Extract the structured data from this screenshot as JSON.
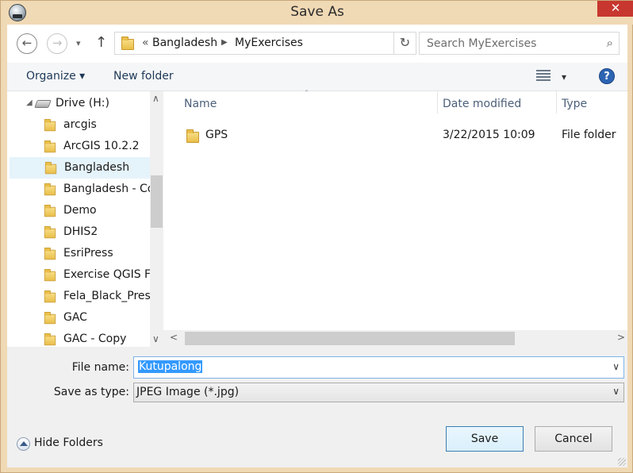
{
  "window": {
    "title": "Save As",
    "close_glyph": "✕"
  },
  "nav": {
    "back_glyph": "←",
    "forward_glyph": "→",
    "recent_glyph": "▾",
    "up_glyph": "↑",
    "address": {
      "overflow": "«",
      "crumbs": [
        "Bangladesh",
        "MyExercises"
      ],
      "separator": "▶",
      "refresh_glyph": "↻"
    },
    "search": {
      "placeholder": "Search MyExercises",
      "value": "",
      "icon_glyph": "⌕"
    }
  },
  "toolbar": {
    "organize_label": "Organize ▾",
    "new_folder_label": "New folder",
    "view_caret": "▾",
    "help_glyph": "?"
  },
  "navpane": {
    "drive_label": "Drive (H:)",
    "drive_arrow": "◢",
    "items": [
      {
        "label": "arcgis",
        "selected": false
      },
      {
        "label": "ArcGIS 10.2.2",
        "selected": false
      },
      {
        "label": "Bangladesh",
        "selected": true
      },
      {
        "label": "Bangladesh - Co",
        "selected": false
      },
      {
        "label": "Demo",
        "selected": false
      },
      {
        "label": "DHIS2",
        "selected": false
      },
      {
        "label": "EsriPress",
        "selected": false
      },
      {
        "label": "Exercise QGIS Fi",
        "selected": false
      },
      {
        "label": "Fela_Black_Presi",
        "selected": false
      },
      {
        "label": "GAC",
        "selected": false
      },
      {
        "label": "GAC - Copy",
        "selected": false
      }
    ],
    "scroll_up": "∧",
    "scroll_down": "∨"
  },
  "files": {
    "columns": {
      "name": "Name",
      "date": "Date modified",
      "type": "Type"
    },
    "sort_glyph": "˄",
    "rows": [
      {
        "name": "GPS",
        "date": "3/22/2015 10:09",
        "type": "File folder"
      }
    ],
    "scroll_left": "<",
    "scroll_right": ">"
  },
  "form": {
    "filename_label": "File name:",
    "filename_value": "Kutupalong",
    "savetype_label": "Save as type:",
    "savetype_value": "JPEG Image (*.jpg)",
    "combo_caret": "∨"
  },
  "footer": {
    "hide_folders_label": "Hide Folders",
    "save_label": "Save",
    "cancel_label": "Cancel"
  },
  "colors": {
    "title_bg": "#f0d9b5",
    "close_bg": "#c7372f",
    "selection": "#3399ff",
    "nav_selected": "#e5f3fb"
  }
}
